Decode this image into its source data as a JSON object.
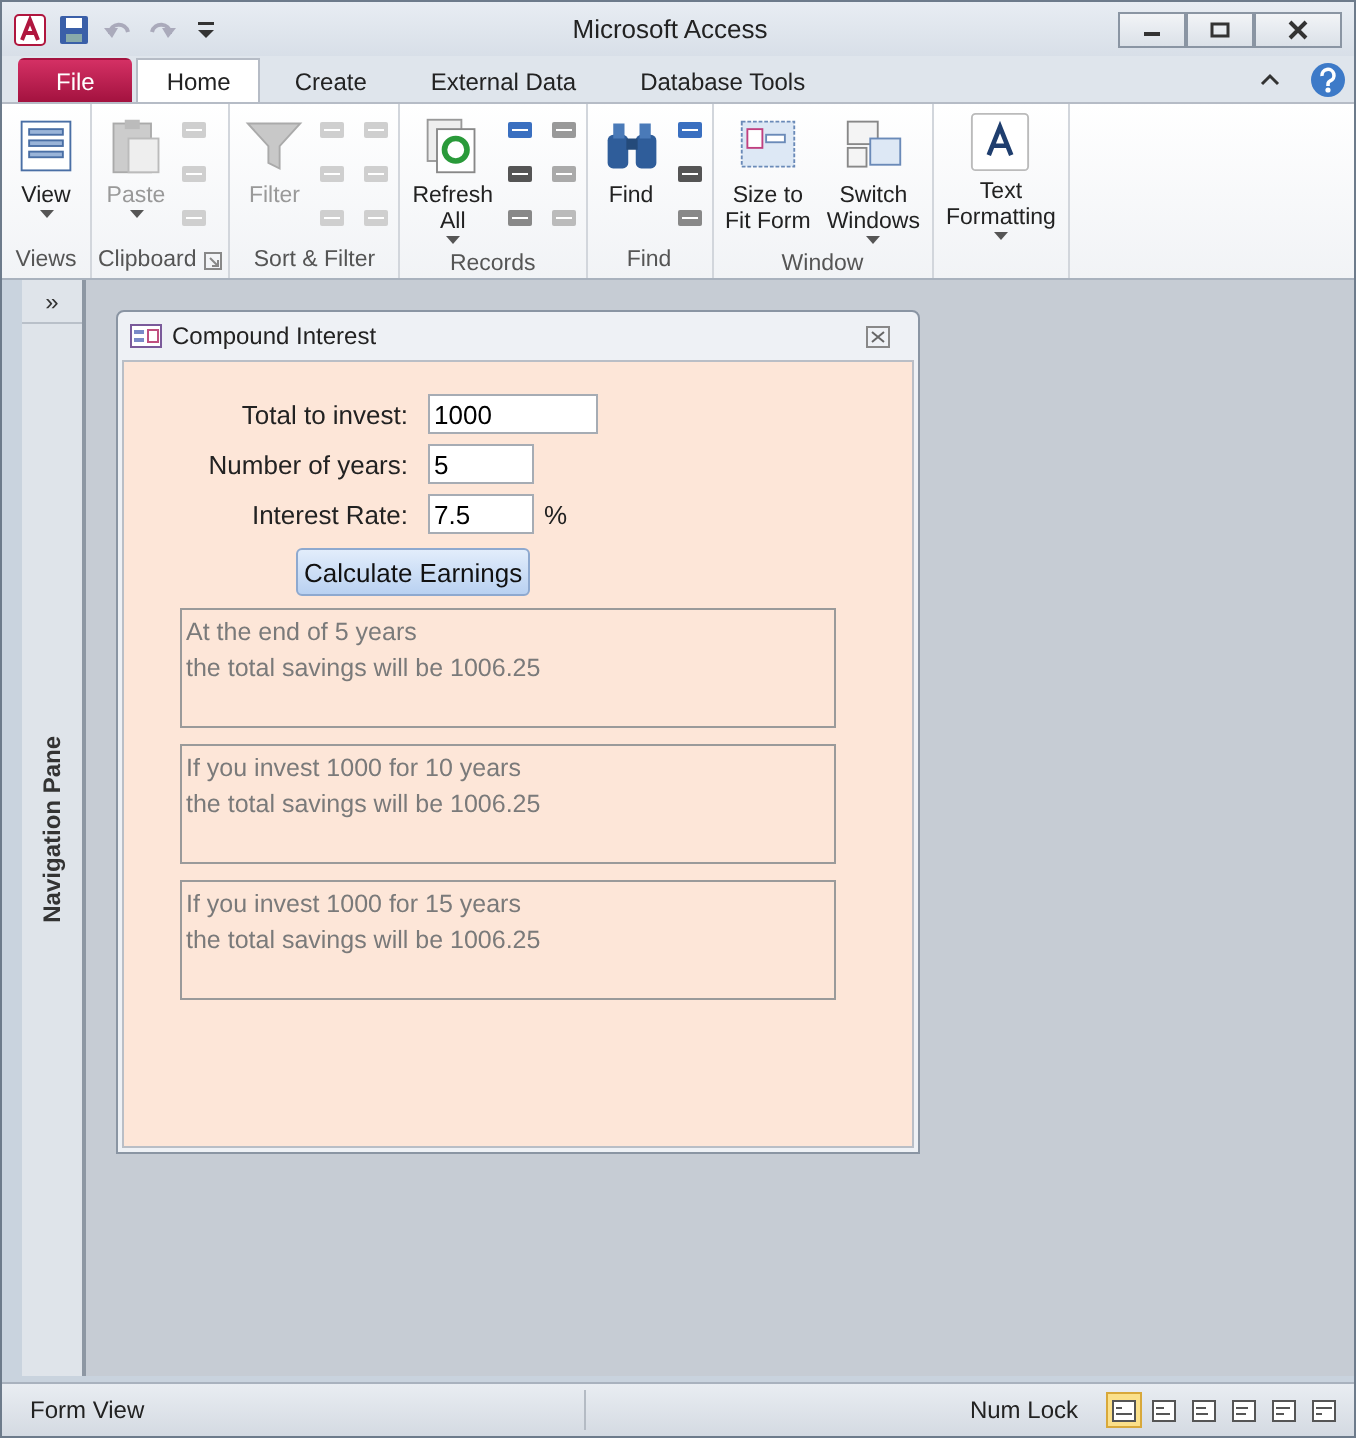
{
  "window": {
    "title": "Microsoft Access"
  },
  "ribbon_tabs": [
    {
      "label": "File",
      "kind": "file",
      "selected": false
    },
    {
      "label": "Home",
      "kind": "tab",
      "selected": true
    },
    {
      "label": "Create",
      "kind": "tab",
      "selected": false
    },
    {
      "label": "External Data",
      "kind": "tab",
      "selected": false
    },
    {
      "label": "Database Tools",
      "kind": "tab",
      "selected": false
    }
  ],
  "ribbon_groups": [
    {
      "label": "Views",
      "buttons": [
        {
          "lines": [
            "View"
          ],
          "kind": "view",
          "dropdown": true,
          "disabled": false
        }
      ],
      "launcher": false
    },
    {
      "label": "Clipboard",
      "buttons": [
        {
          "lines": [
            "Paste"
          ],
          "kind": "paste",
          "dropdown": true,
          "disabled": true
        }
      ],
      "launcher": true
    },
    {
      "label": "Sort & Filter",
      "buttons": [
        {
          "lines": [
            "Filter"
          ],
          "kind": "filter",
          "dropdown": false,
          "disabled": true
        }
      ],
      "launcher": false
    },
    {
      "label": "Records",
      "buttons": [
        {
          "lines": [
            "Refresh",
            "All"
          ],
          "kind": "refresh",
          "dropdown": true,
          "disabled": false
        }
      ],
      "launcher": false
    },
    {
      "label": "Find",
      "buttons": [
        {
          "lines": [
            "Find"
          ],
          "kind": "find",
          "dropdown": false,
          "disabled": false
        }
      ],
      "launcher": false
    },
    {
      "label": "Window",
      "buttons": [
        {
          "lines": [
            "Size to",
            "Fit Form"
          ],
          "kind": "fit",
          "dropdown": false,
          "disabled": false
        },
        {
          "lines": [
            "Switch",
            "Windows"
          ],
          "kind": "switch",
          "dropdown": true,
          "disabled": false
        }
      ],
      "launcher": false
    },
    {
      "buttons": [
        {
          "lines": [
            "Text",
            "Formatting"
          ],
          "kind": "text",
          "dropdown": true,
          "disabled": false
        }
      ]
    }
  ],
  "navigation_pane": {
    "label": "Navigation Pane",
    "toggle": "»"
  },
  "form": {
    "title": "Compound Interest",
    "fields": [
      {
        "label": "Total to invest:",
        "value": "1000",
        "kind": "wide"
      },
      {
        "label": "Number of years:",
        "value": "5",
        "kind": "narrow"
      },
      {
        "label": "Interest Rate:",
        "value": "7.5",
        "kind": "narrow",
        "suffix": "%"
      }
    ],
    "button": "Calculate Earnings",
    "results": [
      {
        "lines": [
          "At the end of 5 years",
          "the total savings will be 1006.25"
        ]
      },
      {
        "lines": [
          "If you invest 1000 for 10 years",
          "the total savings will be 1006.25"
        ]
      },
      {
        "lines": [
          "If you invest 1000 for 15 years",
          "the total savings will be 1006.25"
        ]
      }
    ]
  },
  "status_bar": {
    "mode": "Form View",
    "indicator": "Num Lock",
    "view_buttons": [
      {
        "selected": true
      },
      {
        "selected": false
      },
      {
        "selected": false
      },
      {
        "selected": false
      },
      {
        "selected": false
      },
      {
        "selected": false
      }
    ]
  }
}
